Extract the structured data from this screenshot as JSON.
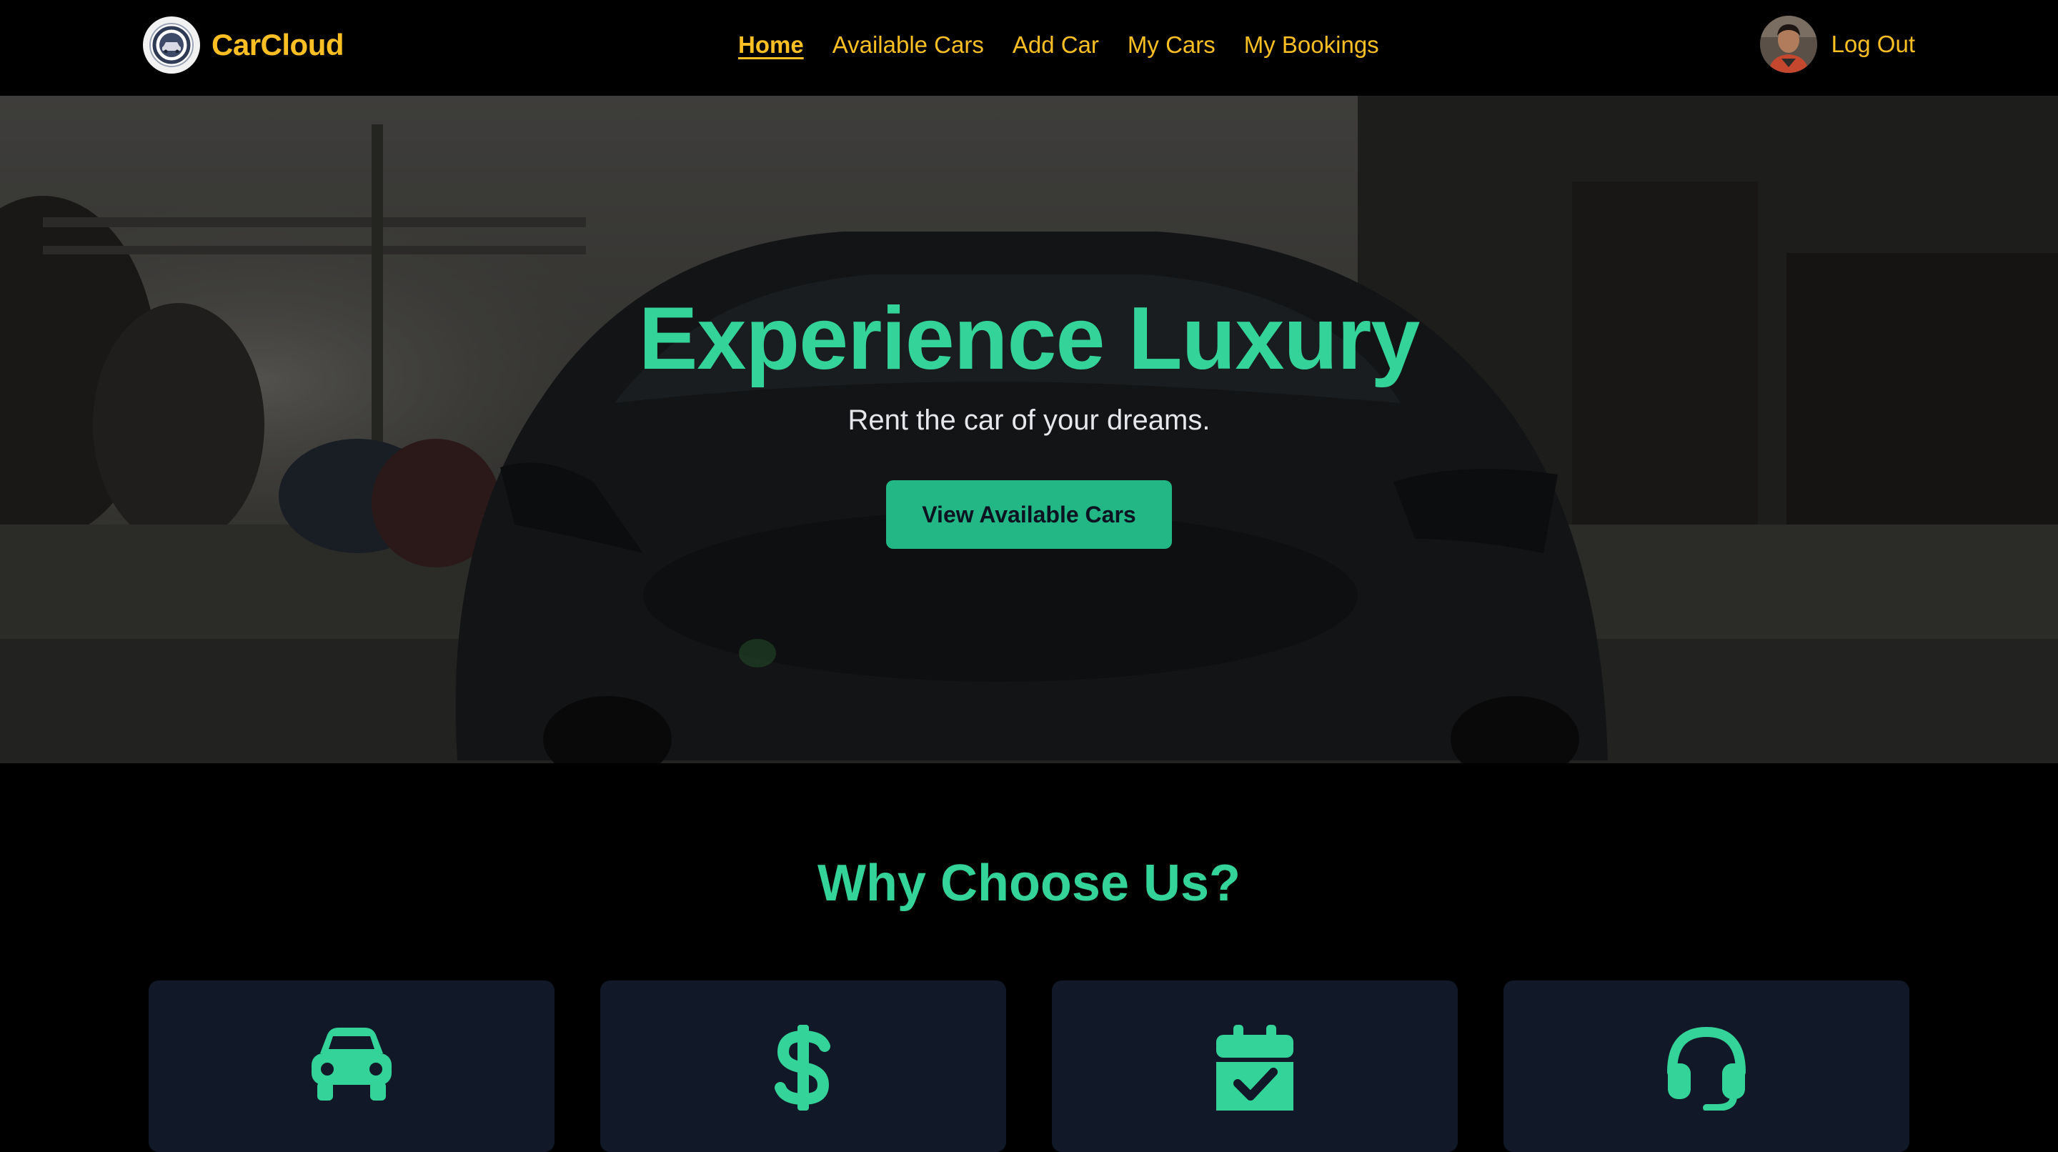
{
  "brand": {
    "name": "CarCloud",
    "logo_icon": "car-club-emblem-icon"
  },
  "nav": {
    "items": [
      {
        "label": "Home",
        "active": true
      },
      {
        "label": "Available Cars",
        "active": false
      },
      {
        "label": "Add Car",
        "active": false
      },
      {
        "label": "My Cars",
        "active": false
      },
      {
        "label": "My Bookings",
        "active": false
      }
    ]
  },
  "user": {
    "avatar_icon": "user-avatar",
    "logout_label": "Log Out"
  },
  "hero": {
    "title": "Experience Luxury",
    "subtitle": "Rent the car of your dreams.",
    "button_label": "View Available Cars",
    "background": "dark supercar on city street"
  },
  "why": {
    "title": "Why Choose Us?",
    "features": [
      {
        "icon": "car-icon"
      },
      {
        "icon": "dollar-icon"
      },
      {
        "icon": "calendar-check-icon"
      },
      {
        "icon": "headset-icon"
      }
    ]
  },
  "colors": {
    "accent": "#34d399",
    "button": "#22b784",
    "nav_text": "#fbbf24",
    "card_bg": "#111827",
    "page_bg": "#000000"
  }
}
